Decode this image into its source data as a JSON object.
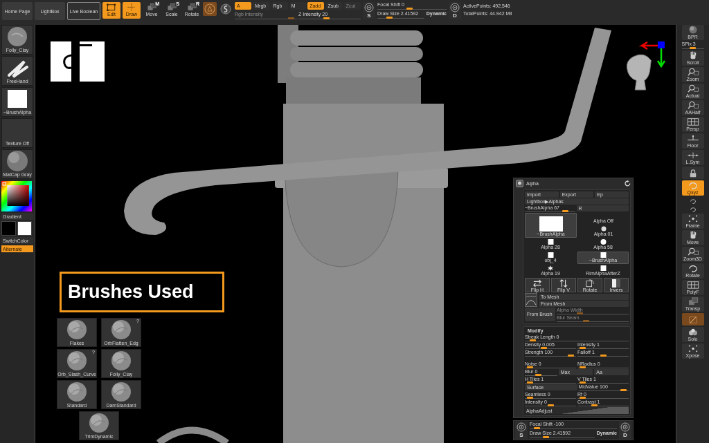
{
  "top_bar": {
    "nav_buttons": [
      {
        "label": "Home Page",
        "kind": "plain"
      },
      {
        "label": "LightBox",
        "kind": "plain"
      },
      {
        "label": "Live Boolean",
        "kind": "outlined"
      }
    ],
    "tools": [
      {
        "label": "Edit",
        "kind": "edit",
        "selected": true
      },
      {
        "label": "Draw",
        "kind": "draw",
        "selected": true
      },
      {
        "label": "Move",
        "kind": "cube",
        "letter": "M",
        "selected": false
      },
      {
        "label": "Scale",
        "kind": "cube",
        "letter": "S",
        "selected": false
      },
      {
        "label": "Rotate",
        "kind": "cube",
        "letter": "R",
        "selected": false
      }
    ],
    "modes": [
      {
        "label": "A",
        "selected": true,
        "disabled": false
      },
      {
        "label": "Mrgb",
        "selected": false,
        "disabled": false
      },
      {
        "label": "Rgb",
        "selected": false,
        "disabled": false
      },
      {
        "label": "M",
        "selected": false,
        "disabled": false
      },
      {
        "label": "Zadd",
        "selected": true,
        "disabled": false
      },
      {
        "label": "Zsub",
        "selected": false,
        "disabled": false
      },
      {
        "label": "Zcut",
        "selected": false,
        "disabled": true
      }
    ],
    "mode_sliders": [
      {
        "label": "Rgb Intensity",
        "level": 0.95,
        "disabled": true
      },
      {
        "label": "Z Intensity 20",
        "level": 0.44,
        "disabled": false
      }
    ],
    "stroke_dial": "S",
    "focal_shift": {
      "label": "Focal Shift  0",
      "level": 0.46
    },
    "draw_size": {
      "label": "Draw Size  2.41592",
      "level": 0.22
    },
    "dynamic": "Dynamic",
    "dynamics_dial": "D",
    "stats": [
      "ActivePoints: 492,546",
      "TotalPoints: 44.942 Mil"
    ]
  },
  "left_shelf": {
    "items": [
      {
        "label": "Folly_Clay",
        "kind": "clay"
      },
      {
        "label": "FreeHand",
        "kind": "stroke"
      },
      {
        "label": "~BrushAlpha",
        "kind": "square"
      },
      {
        "label": "Texture Off",
        "kind": "empty"
      },
      {
        "label": "MatCap Gray",
        "kind": "sphere"
      }
    ],
    "gradient": "Gradient",
    "swatches": [
      {
        "color": "#000000"
      },
      {
        "color": "#ffffff"
      }
    ],
    "switch_color": "SwitchColor",
    "alternate": {
      "label": "Alternate",
      "on": true
    }
  },
  "caption": "Brushes Used",
  "brushes": [
    {
      "label": "Flakes"
    },
    {
      "label": "OrbFlatten_Edg",
      "badge": "?"
    },
    {
      "label": "Orb_Slash_Curve",
      "badge": "?"
    },
    {
      "label": "Folly_Clay"
    },
    {
      "label": "Standard"
    },
    {
      "label": "DamStandard"
    },
    {
      "label": "TrimDynamic"
    }
  ],
  "alpha_panel": {
    "title": "Alpha",
    "top_rows": [
      [
        {
          "kind": "button",
          "label": "Import"
        },
        {
          "kind": "button",
          "label": "Export"
        },
        {
          "kind": "button",
          "label": "Ep"
        }
      ],
      [
        {
          "kind": "button",
          "label": "Lightbox▶Alphas"
        }
      ],
      [
        {
          "kind": "slider",
          "label": "~BrushAlpha  67",
          "level": 0.85
        },
        {
          "kind": "button",
          "label": "R"
        }
      ]
    ],
    "current_alpha": {
      "label": "~BrushAlpha",
      "kind": "big",
      "selected": true
    },
    "side_alphas": [
      {
        "label": "Alpha Off",
        "kind": "none",
        "selected": false
      },
      {
        "label": "Alpha 01",
        "kind": "dot",
        "selected": false
      }
    ],
    "alphas": [
      {
        "label": "Alpha 28",
        "kind": "square",
        "selected": false
      },
      {
        "label": "Alpha 58",
        "kind": "circle",
        "selected": false
      },
      {
        "label": "obj_4",
        "kind": "square",
        "selected": false
      },
      {
        "label": "~BrushAlpha",
        "kind": "square",
        "selected": true
      },
      {
        "label": "Alpha 19",
        "kind": "star",
        "selected": false
      },
      {
        "label": "RimAlphaAfterZ",
        "kind": "square",
        "selected": false
      }
    ],
    "transforms": [
      {
        "label": "Flip H"
      },
      {
        "label": "Flip V"
      },
      {
        "label": "Rotate"
      },
      {
        "label": "Invers"
      }
    ],
    "mesh_buttons": [
      "To Mesh",
      "From Mesh"
    ],
    "from_brush": {
      "label": "From Brush",
      "sliders": [
        {
          "label": "Alpha Width",
          "level": 0.3,
          "disabled": true
        },
        {
          "label": "Blur Seam",
          "level": 0.4,
          "disabled": true
        }
      ]
    },
    "modify": {
      "title": "Modify",
      "rows": [
        [
          {
            "kind": "slider",
            "label": "Streak Length 0",
            "level": 0.05
          }
        ],
        [
          {
            "kind": "slider",
            "label": "Density 0.005",
            "level": 0.35
          },
          {
            "kind": "slider",
            "label": "Intensity 1",
            "level": 0.05
          }
        ],
        [
          {
            "kind": "slider",
            "label": "Strength 100",
            "level": 0.95
          },
          {
            "kind": "slider",
            "label": "Falloff 1",
            "level": 0.5
          }
        ],
        [
          {
            "kind": "gap"
          }
        ],
        [
          {
            "kind": "slider",
            "label": "Noise 0",
            "level": 0.05
          },
          {
            "kind": "slider",
            "label": "NRadius 0",
            "level": 0.05
          }
        ],
        [
          {
            "kind": "slider",
            "label": "Blur 0",
            "level": 0.4
          },
          {
            "kind": "button",
            "label": "Max"
          },
          {
            "kind": "button",
            "label": "Aa"
          }
        ],
        [
          {
            "kind": "slider",
            "label": "H Tiles 1",
            "level": 0.05
          },
          {
            "kind": "slider",
            "label": "V Tiles 1",
            "level": 0.05
          }
        ],
        [
          {
            "kind": "button",
            "label": "Surface"
          },
          {
            "kind": "slider",
            "label": "MidValue 100",
            "level": 0.95
          }
        ],
        [
          {
            "kind": "slider",
            "label": "Seamless 0",
            "level": 0.05
          },
          {
            "kind": "slider",
            "label": "Rf 0",
            "level": 0.05
          }
        ],
        [
          {
            "kind": "slider",
            "label": "Intensity 0",
            "level": 0.5
          },
          {
            "kind": "slider",
            "label": "Contrast 1",
            "level": 0.3
          }
        ],
        [
          {
            "kind": "curve",
            "label": "AlphaAdjust"
          }
        ]
      ]
    }
  },
  "bottom_bar": {
    "stroke_dial": "S",
    "focal_shift": {
      "label": "Focal Shift  -100",
      "level": 0.05
    },
    "draw_size": {
      "label": "Draw Size  2.41592",
      "level": 0.22
    },
    "dynamic": "Dynamic",
    "dynamics_dial": "D"
  },
  "right_shelf": [
    {
      "kind": "sphere",
      "label": "BPR"
    },
    {
      "kind": "slider",
      "label": "SPix 3",
      "level": 0.5
    },
    {
      "kind": "hand",
      "label": "Scroll"
    },
    {
      "kind": "magnifier",
      "label": "Zoom"
    },
    {
      "kind": "magnifier",
      "label": "Actual"
    },
    {
      "kind": "magnifier",
      "label": "AAHalf"
    },
    {
      "kind": "grid",
      "label": "Persp"
    },
    {
      "kind": "floor",
      "label": "Floor"
    },
    {
      "kind": "sym",
      "label": "L.Sym"
    },
    {
      "kind": "lock"
    },
    {
      "kind": "orbit",
      "label": "Qxyz",
      "on": true
    },
    {
      "kind": "orbit-small"
    },
    {
      "kind": "orbit-small"
    },
    {
      "kind": "frame",
      "label": "Frame"
    },
    {
      "kind": "hand",
      "label": "Move"
    },
    {
      "kind": "magnifier",
      "label": "Zoom3D"
    },
    {
      "kind": "orbit",
      "label": "Rotate"
    },
    {
      "kind": "grid",
      "label": "PolyF"
    },
    {
      "kind": "cube",
      "label": "Transp"
    },
    {
      "kind": "ghost",
      "on": true,
      "disabled": true
    },
    {
      "kind": "dots",
      "label": "Solo"
    },
    {
      "kind": "frame",
      "label": "Xpose"
    }
  ]
}
